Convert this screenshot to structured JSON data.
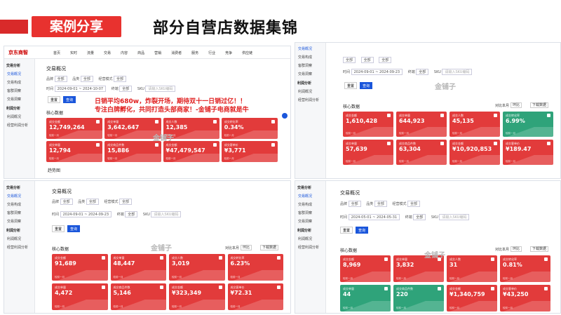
{
  "header": {
    "tag": "案例分享",
    "title": "部分自营店数据集锦"
  },
  "overlay": {
    "line1": "日销平均680w，炸裂开场，期待双十一日销过亿！！",
    "line2": "专注白牌孵化，共同打造头部商家！-金铺子电商就是牛"
  },
  "watermark": {
    "text": "金铺子",
    "sub": "JINPUZI"
  },
  "panel1": {
    "logo": "京东商智",
    "nav": [
      "首页",
      "实时",
      "流量",
      "交易",
      "内容",
      "商品",
      "营销",
      "消费者",
      "服务",
      "行业",
      "竞争",
      "供应链"
    ],
    "side": [
      "交易分析",
      "交易概况",
      "交易构成",
      "客群洞察",
      "交易洞察",
      "利润分析",
      "利润概况",
      "经营利润分析"
    ],
    "section": "交易概况",
    "filters": {
      "brand": "品牌",
      "brand_val": "全部",
      "cat": "品类",
      "cat_val": "全部",
      "mode": "经营模式",
      "mode_val": "全部",
      "time": "时间",
      "time_val": "2024-09-01 ~ 2024-10-07",
      "channel": "终端",
      "channel_val": "全部",
      "sku": "SKU",
      "sku_ph": "请输入SKU编码"
    },
    "buttons": {
      "reset": "重置",
      "query": "查询"
    },
    "core": "核心数据",
    "cards": [
      {
        "label": "成交金额",
        "value": "12,749,264",
        "foot": "较前一月"
      },
      {
        "label": "成交单量",
        "value": "3,642,647",
        "foot": "较前一月"
      },
      {
        "label": "成交人数",
        "value": "12,385",
        "foot": "较前一月"
      },
      {
        "label": "成交转化率",
        "value": "0.34%",
        "foot": "较前一月"
      },
      {
        "label": "成交单量",
        "value": "12,794",
        "foot": "较前一月"
      },
      {
        "label": "成交商品件数",
        "value": "15,886",
        "foot": "较前一月"
      },
      {
        "label": "成交金额",
        "value": "¥47,479,547",
        "foot": "较前一月"
      },
      {
        "label": "成交客单价",
        "value": "¥3,771",
        "foot": "较前一月"
      }
    ],
    "more": "趋势图"
  },
  "panel2": {
    "side": [
      "交易概况",
      "交易构成",
      "客群洞察",
      "交易洞察",
      "利润分析",
      "利润概况",
      "经营利润分析"
    ],
    "filters": {
      "brand_val": "全部",
      "cat_val": "全部",
      "mode_val": "全部",
      "time": "时间",
      "time_val": "2024-09-01 ~ 2024-09-23",
      "channel": "终端",
      "channel_val": "全部",
      "sku": "SKU",
      "sku_ph": "请输入SKU编码"
    },
    "buttons": {
      "reset": "重置",
      "query": "查询"
    },
    "core": "核心数据",
    "compare": "对比本月",
    "compare_val": "环比",
    "download": "下载数据",
    "cards": [
      {
        "label": "成交金额",
        "value": "1,610,428",
        "foot": "较前一月",
        "color": "red"
      },
      {
        "label": "成交单量",
        "value": "644,923",
        "foot": "较前一月",
        "color": "red"
      },
      {
        "label": "成交人数",
        "value": "45,135",
        "foot": "较前一月",
        "color": "red"
      },
      {
        "label": "成交转化率",
        "value": "6.99%",
        "foot": "较前一月",
        "color": "green"
      },
      {
        "label": "成交单量",
        "value": "57,639",
        "foot": "较前一月",
        "color": "red"
      },
      {
        "label": "成交商品件数",
        "value": "63,304",
        "foot": "较前一月",
        "color": "red"
      },
      {
        "label": "成交金额",
        "value": "¥10,920,853",
        "foot": "较前一月",
        "color": "red"
      },
      {
        "label": "成交客单价",
        "value": "¥189.47",
        "foot": "较前一月",
        "color": "red"
      }
    ]
  },
  "panel3": {
    "side": [
      "交易分析",
      "交易概况",
      "交易构成",
      "客群洞察",
      "交易洞察",
      "利润分析",
      "利润概况",
      "经营利润分析"
    ],
    "section": "交易概况",
    "filters": {
      "brand": "品牌",
      "brand_val": "全部",
      "cat": "品类",
      "cat_val": "全部",
      "mode": "经营模式",
      "mode_val": "全部",
      "time": "时间",
      "time_val": "2024-09-01 ~ 2024-09-23",
      "channel": "终端",
      "channel_val": "全部",
      "sku": "SKU",
      "sku_ph": "请输入SKU编码"
    },
    "buttons": {
      "reset": "重置",
      "query": "查询"
    },
    "core": "核心数据",
    "compare": "对比本月",
    "compare_val": "环比",
    "download": "下载数据",
    "cards": [
      {
        "label": "成交金额",
        "value": "91,689",
        "foot": "较前一月"
      },
      {
        "label": "成交单量",
        "value": "48,447",
        "foot": "较前一月"
      },
      {
        "label": "成交人数",
        "value": "3,019",
        "foot": "较前一月"
      },
      {
        "label": "成交转化率",
        "value": "6.23%",
        "foot": "较前一月"
      },
      {
        "label": "成交单量",
        "value": "4,472",
        "foot": "较前一月"
      },
      {
        "label": "成交商品件数",
        "value": "5,146",
        "foot": "较前一月"
      },
      {
        "label": "成交金额",
        "value": "¥323,349",
        "foot": "较前一月"
      },
      {
        "label": "成交客单价",
        "value": "¥72.31",
        "foot": "较前一月"
      }
    ]
  },
  "panel4": {
    "side": [
      "交易分析",
      "交易概况",
      "交易构成",
      "客群洞察",
      "交易洞察",
      "利润分析",
      "利润概况",
      "经营利润分析"
    ],
    "section": "交易概况",
    "filters": {
      "brand": "品牌",
      "brand_val": "全部",
      "cat": "品类",
      "cat_val": "全部",
      "mode": "经营模式",
      "mode_val": "全部",
      "time": "时间",
      "time_val": "2024-05-01 ~ 2024-05-31",
      "channel": "终端",
      "channel_val": "全部",
      "sku": "SKU",
      "sku_ph": "请输入SKU编码"
    },
    "buttons": {
      "reset": "重置",
      "query": "查询"
    },
    "core": "核心数据",
    "compare": "对比本月",
    "compare_val": "环比",
    "download": "下载数据",
    "cards": [
      {
        "label": "成交金额",
        "value": "8,969",
        "foot": "较前一月",
        "color": "red"
      },
      {
        "label": "成交单量",
        "value": "3,832",
        "foot": "较前一月",
        "color": "red"
      },
      {
        "label": "成交人数",
        "value": "31",
        "foot": "较前一月",
        "color": "red"
      },
      {
        "label": "成交转化率",
        "value": "0.81%",
        "foot": "较前一月",
        "color": "red"
      },
      {
        "label": "成交单量",
        "value": "44",
        "foot": "较前一月",
        "color": "green"
      },
      {
        "label": "成交商品件数",
        "value": "220",
        "foot": "较前一月",
        "color": "green"
      },
      {
        "label": "成交金额",
        "value": "¥1,340,759",
        "foot": "较前一月",
        "color": "red"
      },
      {
        "label": "成交客单价",
        "value": "¥43,250",
        "foot": "较前一月",
        "color": "red"
      }
    ]
  }
}
